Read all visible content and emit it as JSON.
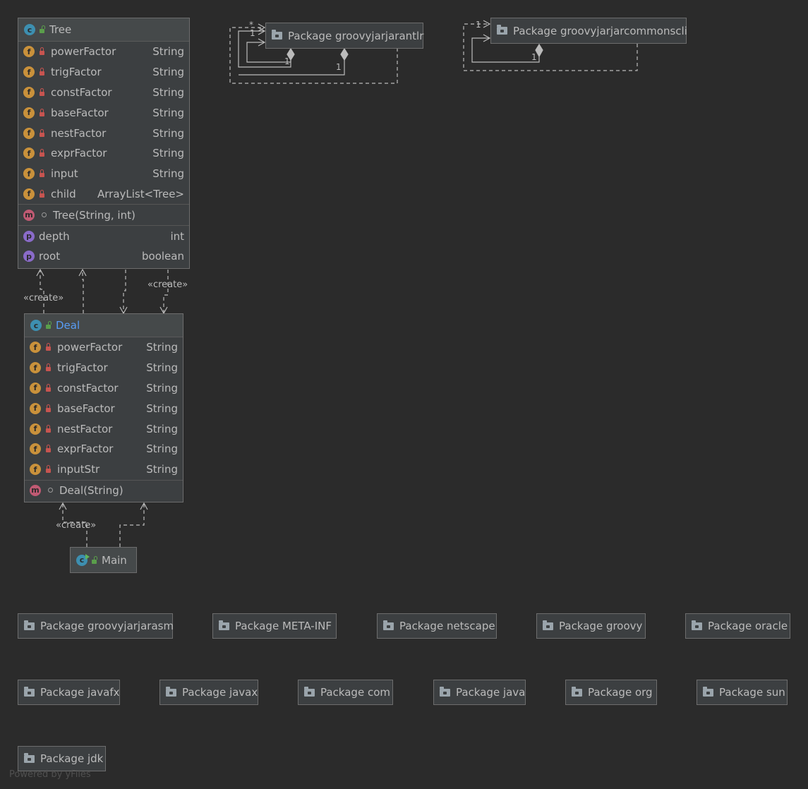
{
  "classes": {
    "tree": {
      "title": "Tree",
      "fields": [
        {
          "name": "powerFactor",
          "type": "String"
        },
        {
          "name": "trigFactor",
          "type": "String"
        },
        {
          "name": "constFactor",
          "type": "String"
        },
        {
          "name": "baseFactor",
          "type": "String"
        },
        {
          "name": "nestFactor",
          "type": "String"
        },
        {
          "name": "exprFactor",
          "type": "String"
        },
        {
          "name": "input",
          "type": "String"
        },
        {
          "name": "child",
          "type": "ArrayList<Tree>"
        }
      ],
      "methods": [
        {
          "name": "Tree(String, int)"
        }
      ],
      "properties": [
        {
          "name": "depth",
          "type": "int"
        },
        {
          "name": "root",
          "type": "boolean"
        }
      ]
    },
    "deal": {
      "title": "Deal",
      "fields": [
        {
          "name": "powerFactor",
          "type": "String"
        },
        {
          "name": "trigFactor",
          "type": "String"
        },
        {
          "name": "constFactor",
          "type": "String"
        },
        {
          "name": "baseFactor",
          "type": "String"
        },
        {
          "name": "nestFactor",
          "type": "String"
        },
        {
          "name": "exprFactor",
          "type": "String"
        },
        {
          "name": "inputStr",
          "type": "String"
        }
      ],
      "methods": [
        {
          "name": "Deal(String)"
        }
      ]
    },
    "main": {
      "title": "Main"
    }
  },
  "icon_letters": {
    "class": "c",
    "field": "f",
    "method": "m",
    "property": "p"
  },
  "edge_labels": {
    "create_left": "«create»",
    "create_right": "«create»",
    "create_main": "«create»"
  },
  "multiplicities": {
    "antlr_star": "*",
    "antlr_one_a": "1",
    "antlr_one_b": "1",
    "antlr_one_c": "1",
    "cli_one_a": "1",
    "cli_one_b": "1"
  },
  "packages": {
    "antlr": "Package groovyjarjarantlr",
    "commonscli": "Package groovyjarjarcommonscli",
    "asm": "Package groovyjarjarasm",
    "metainf": "Package META-INF",
    "netscape": "Package netscape",
    "groovy": "Package groovy",
    "oracle": "Package oracle",
    "javafx": "Package javafx",
    "javax": "Package javax",
    "com": "Package com",
    "java": "Package java",
    "org": "Package org",
    "sun": "Package sun",
    "jdk": "Package jdk"
  },
  "watermark": "Powered by yFiles",
  "colors": {
    "background": "#2b2b2b",
    "node": "#3c3f41",
    "field_icon": "#c9913b",
    "class_icon": "#3d8fb0",
    "method_icon": "#c05a73",
    "property_icon": "#8a6bc9",
    "private_lock": "#c75450",
    "public_lock": "#5a9e4b",
    "deal_title": "#589df6"
  }
}
